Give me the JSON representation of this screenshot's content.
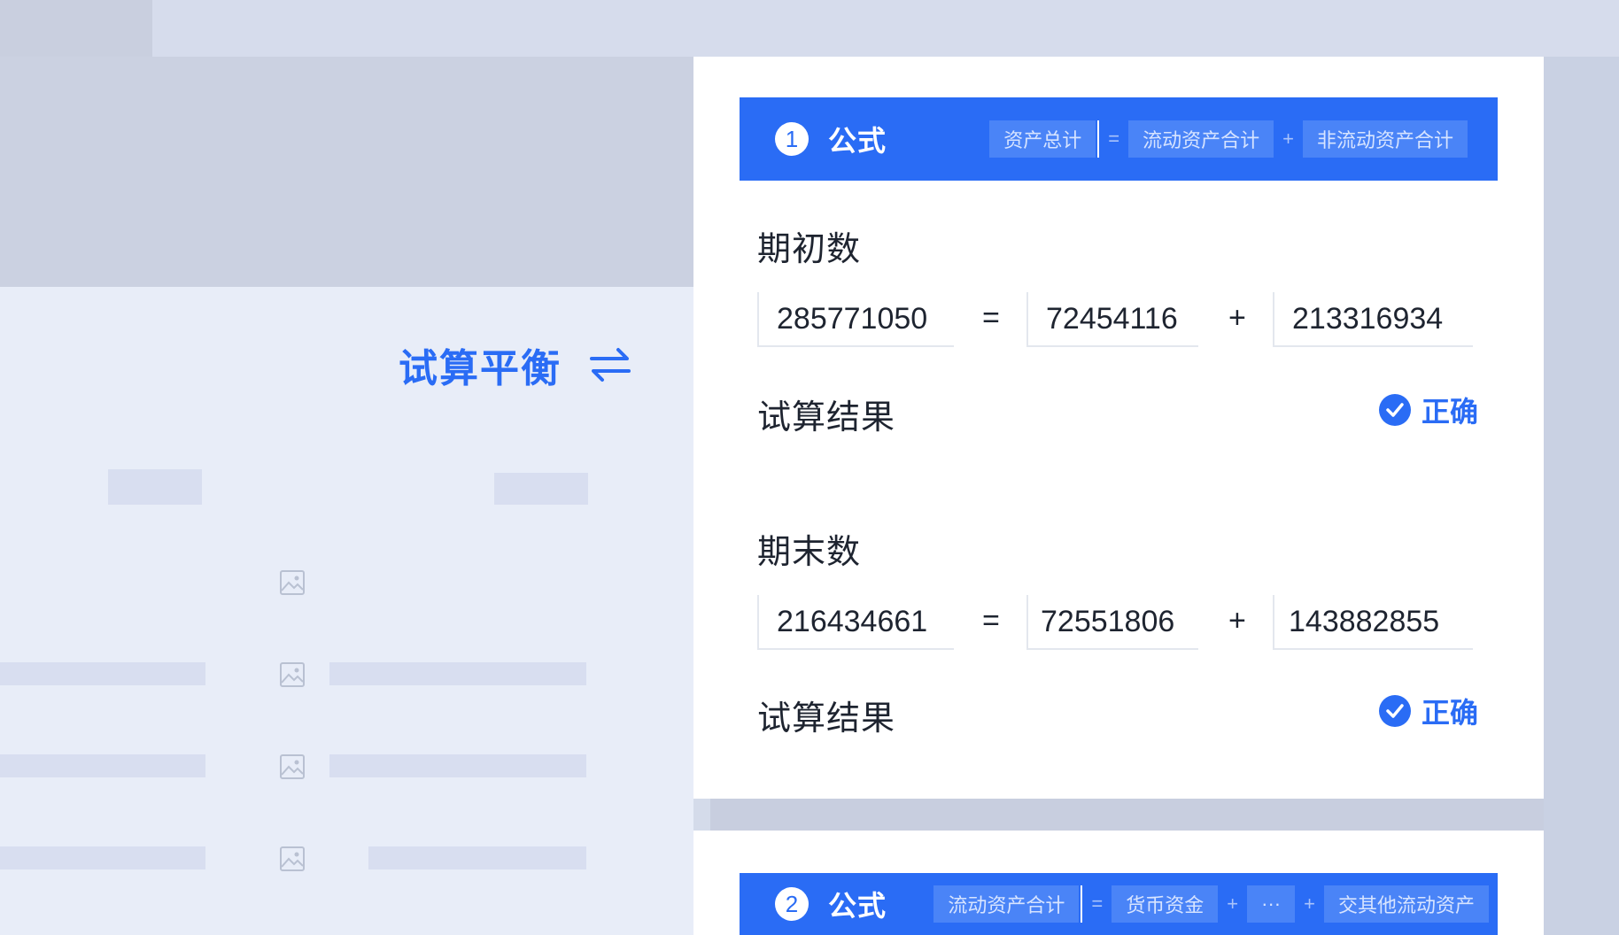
{
  "side": {
    "title": "试算平衡",
    "title_icon": "swap-arrows-icon"
  },
  "accent_color": "#2a6cf5",
  "formula1": {
    "index": "1",
    "label": "公式",
    "tokens": [
      "资产总计",
      "流动资产合计",
      "非流动资产合计"
    ],
    "ops": [
      "=",
      "+"
    ]
  },
  "opening": {
    "title": "期初数",
    "values": [
      "285771050",
      "72454116",
      "213316934"
    ],
    "ops": [
      "=",
      "+"
    ],
    "result_label": "试算结果",
    "result_status": "正确"
  },
  "closing": {
    "title": "期末数",
    "values": [
      "216434661",
      "72551806",
      "143882855"
    ],
    "ops": [
      "=",
      "+"
    ],
    "result_label": "试算结果",
    "result_status": "正确"
  },
  "formula2": {
    "index": "2",
    "label": "公式",
    "tokens": [
      "流动资产合计",
      "货币资金",
      "···",
      "交其他流动资产"
    ],
    "ops": [
      "=",
      "+",
      "+"
    ]
  }
}
